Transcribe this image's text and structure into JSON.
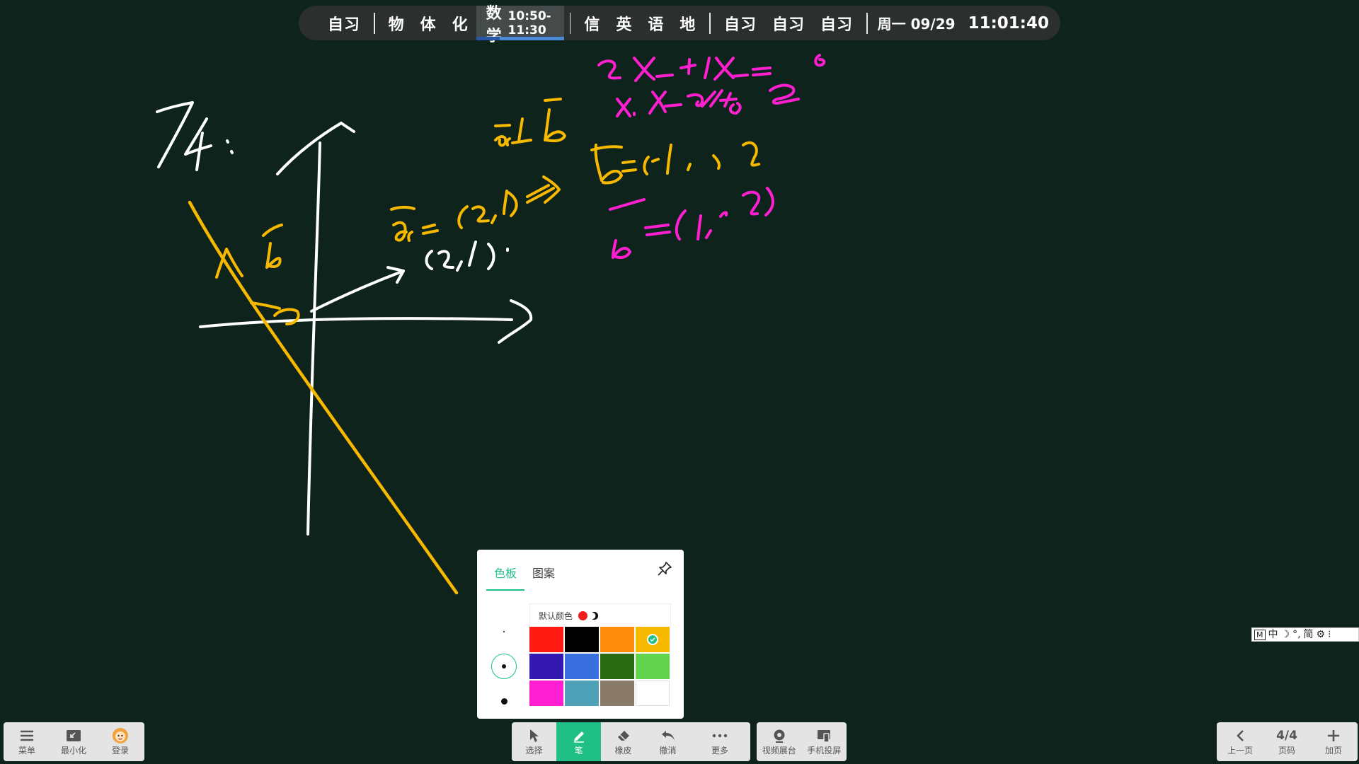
{
  "schedule": {
    "group1": [
      "自习"
    ],
    "group2_before": [
      "物",
      "体",
      "化"
    ],
    "current": {
      "subject": "数学",
      "time": "10:50-11:30",
      "progress_fraction": 0.27
    },
    "group3": [
      "信",
      "英",
      "语",
      "地"
    ],
    "group4": [
      "自习",
      "自习",
      "自习"
    ],
    "date": "周一 09/29",
    "clock": "11:01:40"
  },
  "toolbar_left": [
    {
      "label": "菜单",
      "icon": "menu-icon"
    },
    {
      "label": "最小化",
      "icon": "minimize-icon"
    },
    {
      "label": "登录",
      "icon": "avatar-icon"
    }
  ],
  "toolbar_mid": [
    {
      "label": "选择",
      "icon": "cursor-icon"
    },
    {
      "label": "笔",
      "icon": "pen-icon",
      "active": true
    },
    {
      "label": "橡皮",
      "icon": "eraser-icon"
    },
    {
      "label": "撤消",
      "icon": "undo-icon"
    },
    {
      "label": "更多",
      "icon": "more-icon"
    }
  ],
  "toolbar_media": [
    {
      "label": "视频展台",
      "icon": "camera-icon"
    },
    {
      "label": "手机投屏",
      "icon": "phone-cast-icon"
    }
  ],
  "toolbar_page": {
    "prev_label": "上一页",
    "page_value": "4/4",
    "page_label": "页码",
    "add_label": "加页"
  },
  "palette": {
    "tab_color": "色板",
    "tab_pattern": "图案",
    "default_color_label": "默认颜色",
    "selected_color": "#f7b800",
    "selected_size": "medium",
    "swatches": [
      "#ff1a12",
      "#000000",
      "#ff8c0a",
      "#f7b800",
      "#3419b0",
      "#3a6fe0",
      "#2a6a12",
      "#63d24c",
      "#ff1fd0",
      "#4ea1b6",
      "#8a7a6a",
      "#ffffff"
    ]
  },
  "ime": {
    "items": [
      "M",
      "中",
      "☽",
      "°,",
      "简",
      "⚙",
      "⁝"
    ]
  },
  "ink_colors": {
    "white": "#ffffff",
    "yellow": "#f7b800",
    "magenta": "#ff1fd0"
  }
}
